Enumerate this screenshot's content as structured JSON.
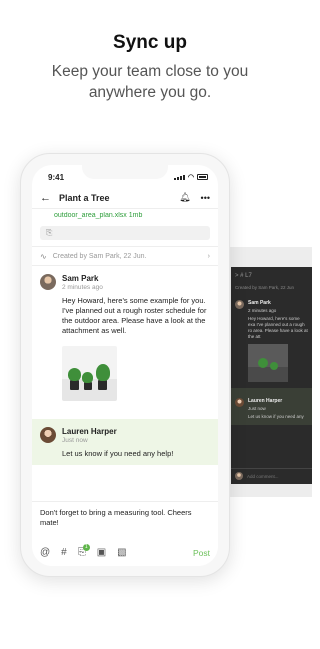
{
  "headline": "Sync up",
  "subline": "Keep your team close to you anywhere you go.",
  "phone": {
    "status_time": "9:41",
    "nav_title": "Plant a Tree",
    "file_name": "outdoor_area_plan.xlsx 1mb",
    "activity_text": "Created by Sam Park, 22 Jun.",
    "messages": [
      {
        "name": "Sam Park",
        "time": "2 minutes ago",
        "text": "Hey Howard, here's some example for you. I've planned out a rough roster schedule for the outdoor area. Please have a look at the attachment as well."
      },
      {
        "name": "Lauren Harper",
        "time": "Just now",
        "text": "Let us know if you need any help!"
      }
    ],
    "composer_draft": "Don't forget to bring a measuring tool. Cheers mate!",
    "attach_badge": "1",
    "post_label": "Post"
  },
  "tablet": {
    "channel": "# L7",
    "created": "Created by Sam Park, 22 Jun",
    "msg1_name": "Sam Park",
    "msg1_time": "2 minutes ago",
    "msg1_text": "Hey Howard, here's some exa I've planned out a rough ro area. Please have a look at the att",
    "msg2_name": "Lauren Harper",
    "msg2_time": "Just now",
    "msg2_text": "Let us know if you need any",
    "composer_placeholder": "Add comment..."
  },
  "colors": {
    "accent": "#6cc05a",
    "highlight": "#eef6e6",
    "tablet_bg": "#2b2b2b"
  }
}
